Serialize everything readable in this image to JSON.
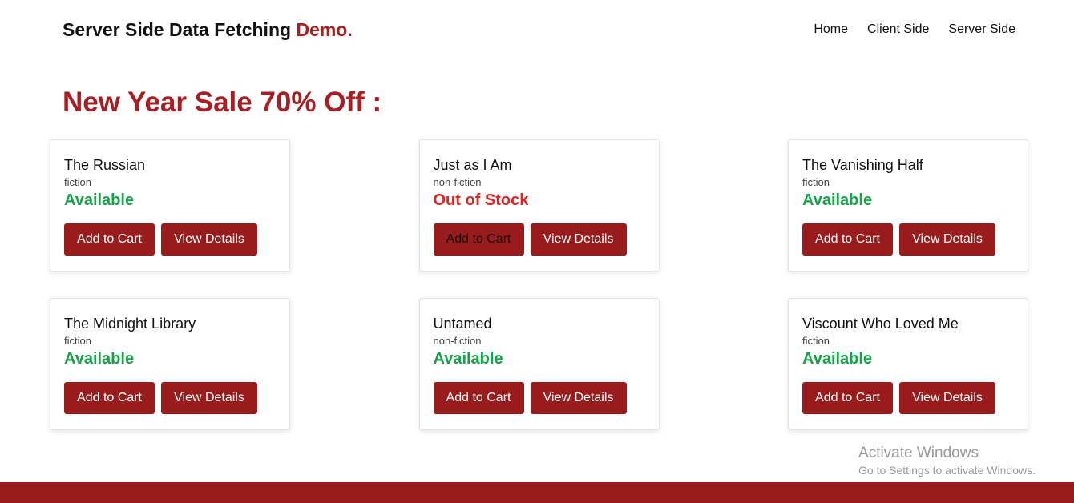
{
  "header": {
    "brand_text": "Server Side Data Fetching",
    "brand_accent": "Demo.",
    "nav": [
      "Home",
      "Client Side",
      "Server Side"
    ]
  },
  "main": {
    "heading": "New Year Sale 70% Off :"
  },
  "books": [
    {
      "title": "The Russian",
      "category": "fiction",
      "status": "Available",
      "in_stock": true
    },
    {
      "title": "Just as I Am",
      "category": "non-fiction",
      "status": "Out of Stock",
      "in_stock": false
    },
    {
      "title": "The Vanishing Half",
      "category": "fiction",
      "status": "Available",
      "in_stock": true
    },
    {
      "title": "The Midnight Library",
      "category": "fiction",
      "status": "Available",
      "in_stock": true
    },
    {
      "title": "Untamed",
      "category": "non-fiction",
      "status": "Available",
      "in_stock": true
    },
    {
      "title": "Viscount Who Loved Me",
      "category": "fiction",
      "status": "Available",
      "in_stock": true
    }
  ],
  "buttons": {
    "add_to_cart": "Add to Cart",
    "view_details": "View Details"
  },
  "watermark": {
    "title": "Activate Windows",
    "subtitle": "Go to Settings to activate Windows."
  },
  "colors": {
    "brand_red": "#991b1b",
    "heading_red": "#a91e23",
    "available_green": "#16a34a",
    "out_of_stock_red": "#dc2626"
  }
}
